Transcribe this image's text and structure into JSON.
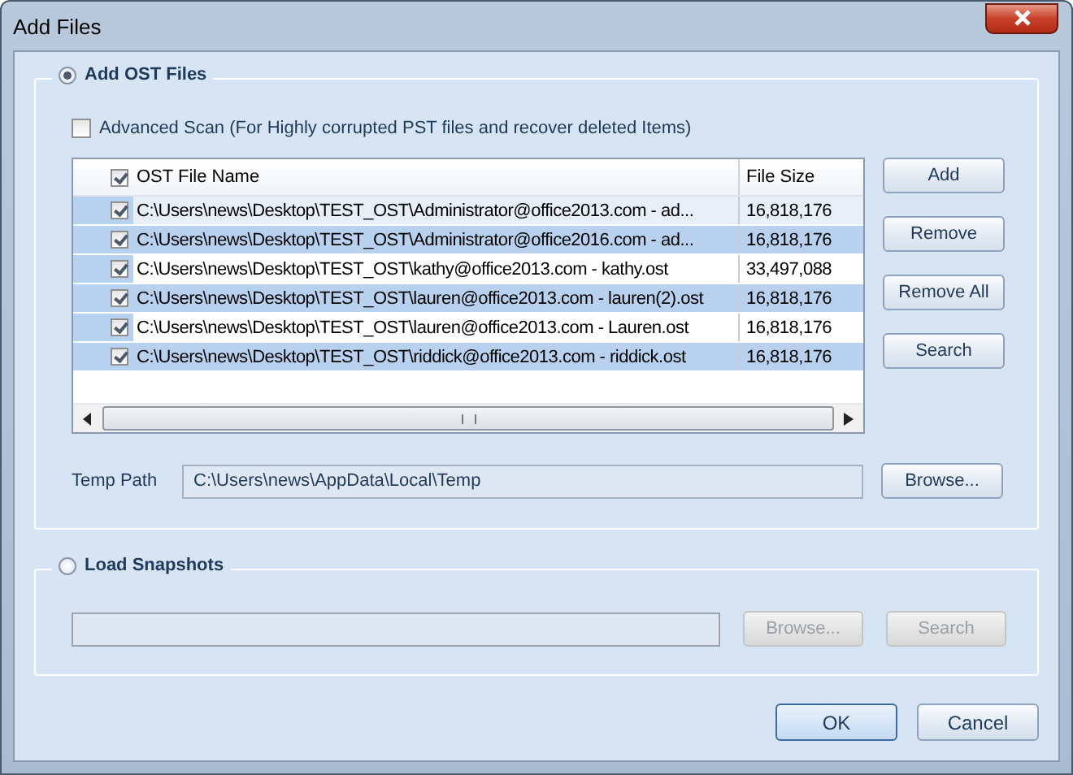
{
  "window": {
    "title": "Add Files"
  },
  "add_ost": {
    "label": "Add OST Files",
    "selected": true,
    "advanced_scan": {
      "label": "Advanced Scan  (For Highly corrupted PST files and recover deleted Items)",
      "checked": false
    },
    "table": {
      "header_checked": true,
      "columns": [
        "OST File Name",
        "File Size"
      ],
      "rows": [
        {
          "checked": true,
          "selected": false,
          "name": "C:\\Users\\news\\Desktop\\TEST_OST\\Administrator@office2013.com - ad...",
          "size": "16,818,176"
        },
        {
          "checked": true,
          "selected": true,
          "name": "C:\\Users\\news\\Desktop\\TEST_OST\\Administrator@office2016.com - ad...",
          "size": "16,818,176"
        },
        {
          "checked": true,
          "selected": false,
          "name": "C:\\Users\\news\\Desktop\\TEST_OST\\kathy@office2013.com - kathy.ost",
          "size": "33,497,088"
        },
        {
          "checked": true,
          "selected": true,
          "name": "C:\\Users\\news\\Desktop\\TEST_OST\\lauren@office2013.com - lauren(2).ost",
          "size": "16,818,176"
        },
        {
          "checked": true,
          "selected": false,
          "name": "C:\\Users\\news\\Desktop\\TEST_OST\\lauren@office2013.com - Lauren.ost",
          "size": "16,818,176"
        },
        {
          "checked": true,
          "selected": true,
          "name": "C:\\Users\\news\\Desktop\\TEST_OST\\riddick@office2013.com - riddick.ost",
          "size": "16,818,176"
        }
      ]
    },
    "buttons": [
      {
        "label": "Add",
        "disabled": false
      },
      {
        "label": "Remove",
        "disabled": false
      },
      {
        "label": "Remove All",
        "disabled": false
      },
      {
        "label": "Search",
        "disabled": false
      }
    ],
    "temp_path": {
      "label": "Temp Path",
      "value": "C:\\Users\\news\\AppData\\Local\\Temp"
    },
    "browse_button": {
      "label": "Browse...",
      "disabled": false
    }
  },
  "load_snapshots": {
    "label": "Load Snapshots",
    "selected": false,
    "buttons": [
      {
        "label": "Browse...",
        "disabled": true
      },
      {
        "label": "Search",
        "disabled": true
      }
    ]
  },
  "dialog_buttons": [
    {
      "label": "OK",
      "default": true
    },
    {
      "label": "Cancel",
      "default": false
    }
  ]
}
